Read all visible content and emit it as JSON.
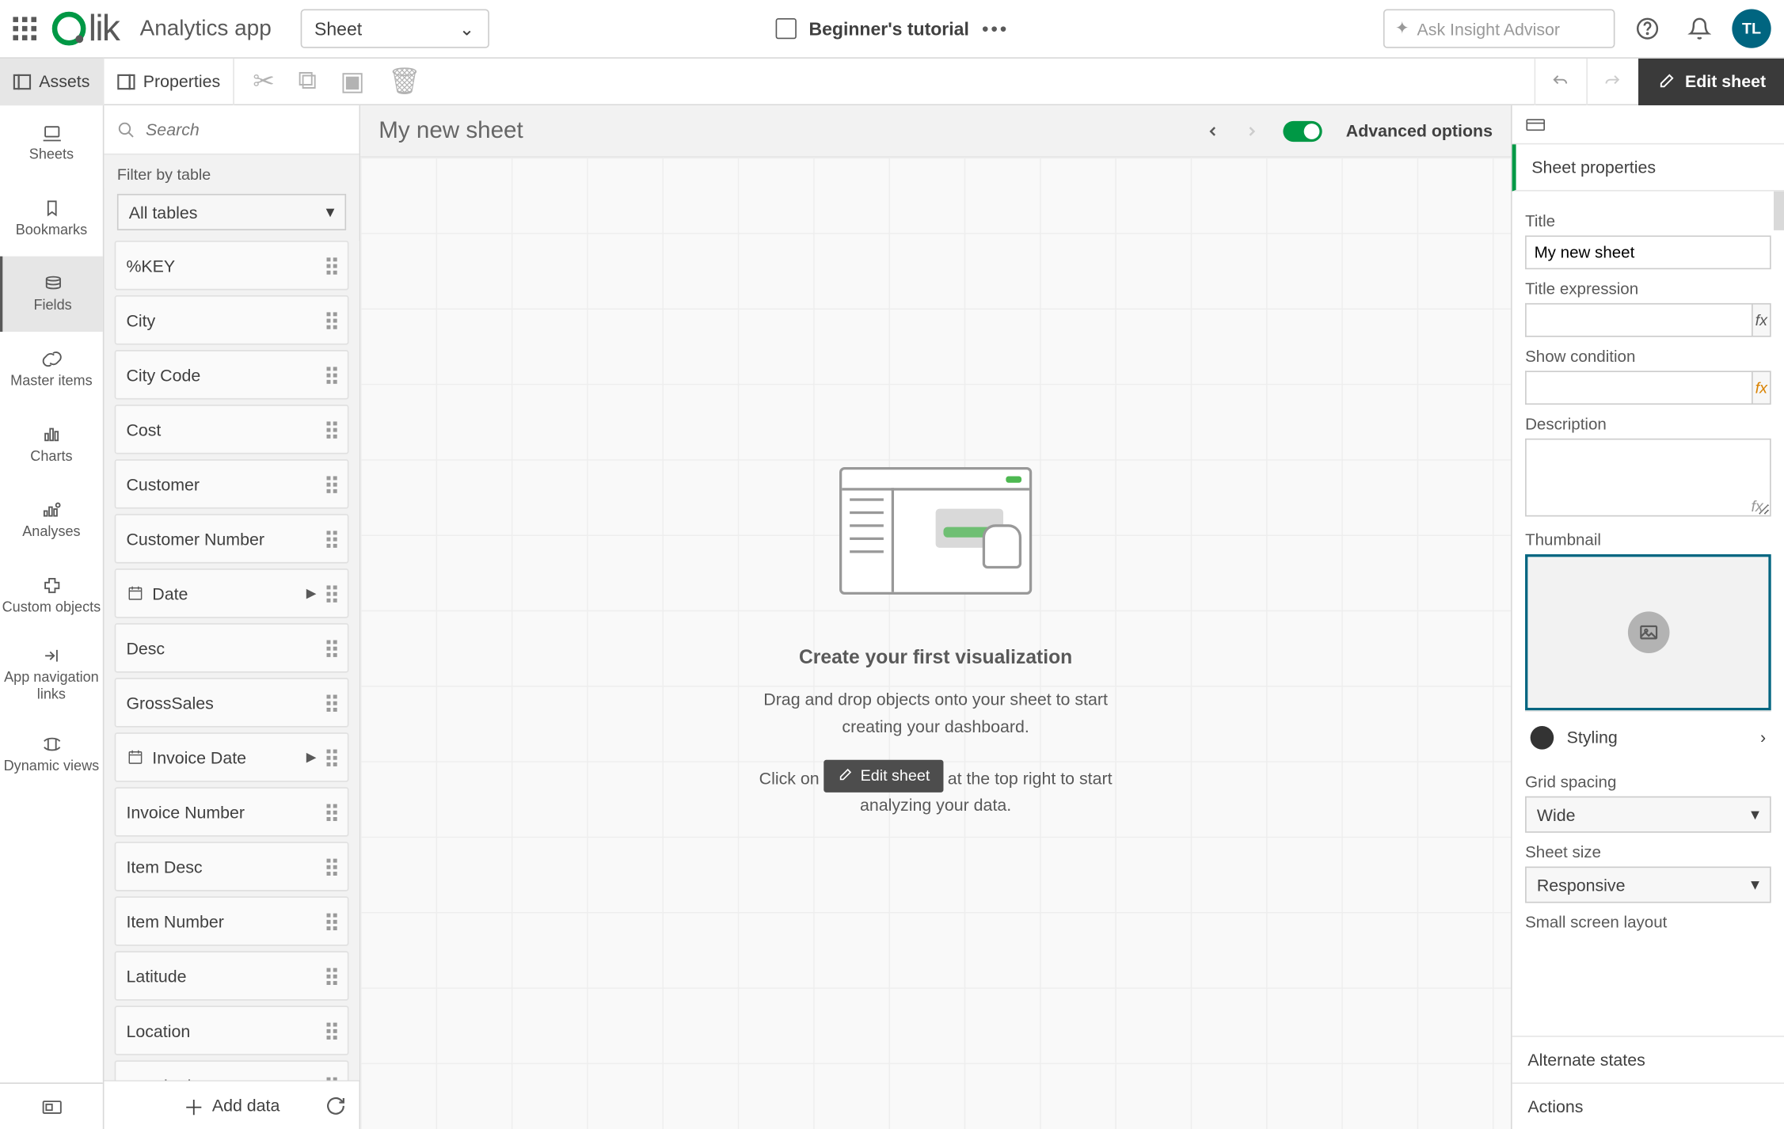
{
  "topbar": {
    "app_name": "Analytics app",
    "sheet_dd": "Sheet",
    "tutorial": "Beginner's tutorial",
    "insight_placeholder": "Ask Insight Advisor",
    "avatar": "TL"
  },
  "toolbar": {
    "assets": "Assets",
    "properties": "Properties",
    "edit_sheet": "Edit sheet"
  },
  "rail": {
    "items": [
      "Sheets",
      "Bookmarks",
      "Fields",
      "Master items",
      "Charts",
      "Analyses",
      "Custom objects",
      "App navigation links",
      "Dynamic views"
    ]
  },
  "assets": {
    "search_placeholder": "Search",
    "filter_label": "Filter by table",
    "filter_value": "All tables",
    "fields": [
      {
        "name": "%KEY"
      },
      {
        "name": "City"
      },
      {
        "name": "City Code"
      },
      {
        "name": "Cost"
      },
      {
        "name": "Customer"
      },
      {
        "name": "Customer Number"
      },
      {
        "name": "Date",
        "date": true
      },
      {
        "name": "Desc"
      },
      {
        "name": "GrossSales"
      },
      {
        "name": "Invoice Date",
        "date": true
      },
      {
        "name": "Invoice Number"
      },
      {
        "name": "Item Desc"
      },
      {
        "name": "Item Number"
      },
      {
        "name": "Latitude"
      },
      {
        "name": "Location"
      },
      {
        "name": "Longitude"
      }
    ],
    "add_data": "Add data"
  },
  "canvas": {
    "sheet_title": "My new sheet",
    "adv_label": "Advanced options",
    "empty_title": "Create your first visualization",
    "empty_line1": "Drag and drop objects onto your sheet to start creating your dashboard.",
    "empty_pre": "Click on ",
    "empty_chip": "Edit sheet",
    "empty_post": " at the top right to start analyzing your data."
  },
  "props": {
    "header": "Sheet properties",
    "title_label": "Title",
    "title_value": "My new sheet",
    "title_expr_label": "Title expression",
    "show_cond_label": "Show condition",
    "desc_label": "Description",
    "thumb_label": "Thumbnail",
    "styling": "Styling",
    "grid_spacing_label": "Grid spacing",
    "grid_spacing_value": "Wide",
    "sheet_size_label": "Sheet size",
    "sheet_size_value": "Responsive",
    "small_screen_label": "Small screen layout",
    "alt_states": "Alternate states",
    "actions": "Actions"
  }
}
